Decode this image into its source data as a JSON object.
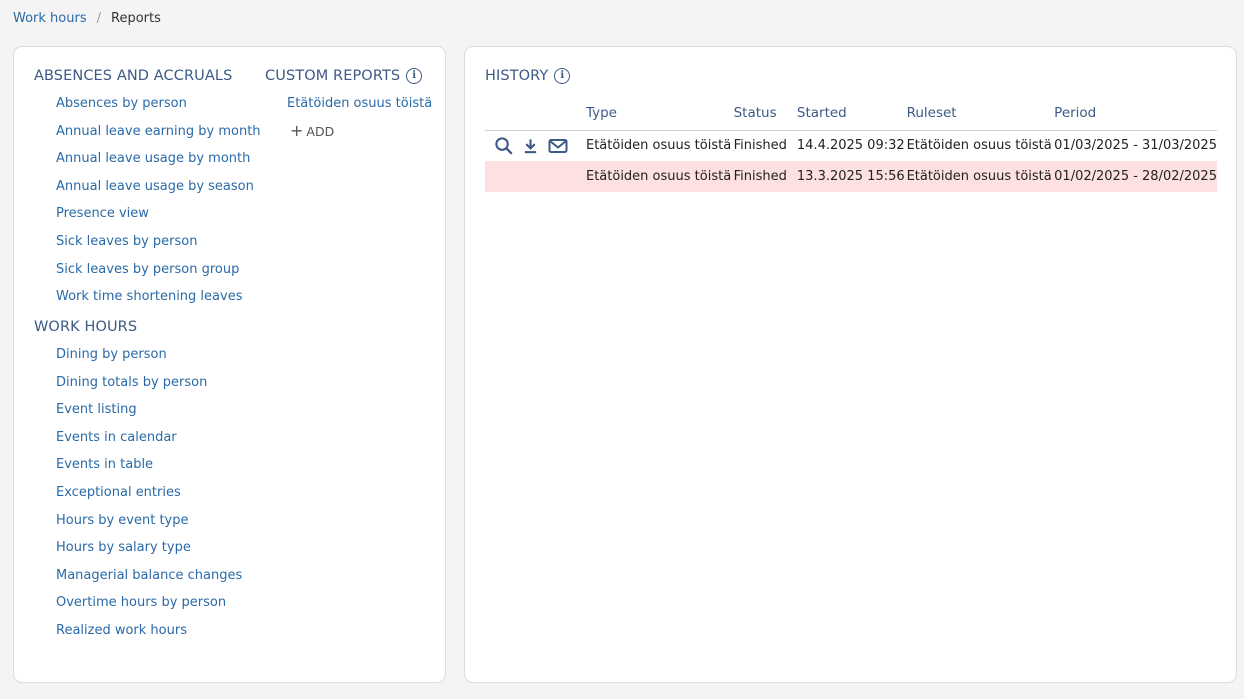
{
  "breadcrumb": {
    "parent": "Work hours",
    "separator": "/",
    "current": "Reports"
  },
  "absences": {
    "title": "ABSENCES AND ACCRUALS",
    "items": [
      "Absences by person",
      "Annual leave earning by month",
      "Annual leave usage by month",
      "Annual leave usage by season",
      "Presence view",
      "Sick leaves by person",
      "Sick leaves by person group",
      "Work time shortening leaves"
    ]
  },
  "work_hours": {
    "title": "WORK HOURS",
    "items": [
      "Dining by person",
      "Dining totals by person",
      "Event listing",
      "Events in calendar",
      "Events in table",
      "Exceptional entries",
      "Hours by event type",
      "Hours by salary type",
      "Managerial balance changes",
      "Overtime hours by person",
      "Realized work hours"
    ]
  },
  "custom_reports": {
    "title": "CUSTOM REPORTS",
    "items": [
      "Etätöiden osuus töistä"
    ],
    "add_label": "ADD"
  },
  "history": {
    "title": "HISTORY",
    "columns": [
      "Type",
      "Status",
      "Started",
      "Ruleset",
      "Period"
    ],
    "rows": [
      {
        "type": "Etätöiden osuus töistä",
        "status": "Finished",
        "started": "14.4.2025 09:32",
        "ruleset": "Etätöiden osuus töistä",
        "period": "01/03/2025 - 31/03/2025",
        "has_actions": true
      },
      {
        "type": "Etätöiden osuus töistä",
        "status": "Finished",
        "started": "13.3.2025 15:56",
        "ruleset": "Etätöiden osuus töistä",
        "period": "01/02/2025 - 28/02/2025",
        "has_actions": false
      }
    ]
  },
  "colors": {
    "link": "#2a6aa8",
    "heading": "#3d5a86",
    "error_row": "#fde0e0"
  },
  "icons": [
    "info-icon",
    "search-icon",
    "download-icon",
    "mail-icon",
    "plus-icon"
  ]
}
